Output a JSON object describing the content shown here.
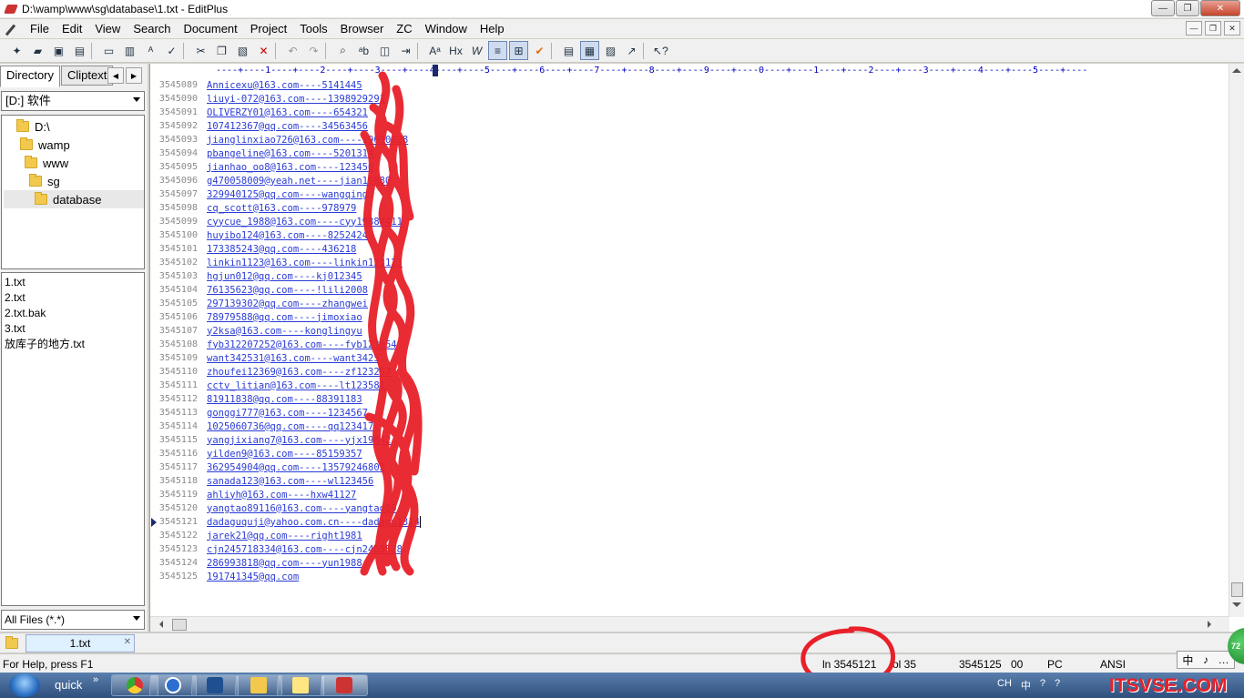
{
  "window": {
    "title": "D:\\wamp\\www\\sg\\database\\1.txt - EditPlus",
    "buttons": {
      "minimize": "—",
      "maximize": "❐",
      "close": "✕"
    }
  },
  "menu": {
    "items": [
      "File",
      "Edit",
      "View",
      "Search",
      "Document",
      "Project",
      "Tools",
      "Browser",
      "ZC",
      "Window",
      "Help"
    ],
    "mdi": {
      "minimize": "—",
      "restore": "❐",
      "close": "✕"
    }
  },
  "toolbar": {
    "icons": [
      "new-file-icon",
      "open-icon",
      "save-icon",
      "save-all-icon",
      "print-preview-icon",
      "print-icon",
      "spell-check-icon",
      "check-icon",
      "cut-icon",
      "copy-icon",
      "paste-icon",
      "delete-icon",
      "undo-icon",
      "redo-icon",
      "find-icon",
      "replace-icon",
      "goto-icon",
      "indent-icon",
      "font-icon",
      "hex-icon",
      "word-wrap-icon",
      "line-number-icon",
      "column-icon",
      "spellcheck-mark-icon",
      "browser-icon",
      "window-icon",
      "cliptext-icon",
      "export-icon",
      "help-icon"
    ]
  },
  "left_panel": {
    "tabs": [
      "Directory",
      "Cliptext"
    ],
    "drive": "[D:] 软件",
    "tree": [
      "D:\\",
      "wamp",
      "www",
      "sg",
      "database"
    ],
    "files": [
      "1.txt",
      "2.txt",
      "2.txt.bak",
      "3.txt",
      "放库子的地方.txt"
    ],
    "filter": "All Files (*.*)"
  },
  "editor": {
    "ruler": "----+----1----+----2----+----3----+----4----+----5----+----6----+----7----+----8----+----9----+----0----+----1----+----2----+----3----+----4----+----5----+----",
    "lines": [
      {
        "num": "3545089",
        "text": "Annicexu@163.com----5141445"
      },
      {
        "num": "3545090",
        "text": "liuyi-072@163.com----1398929291"
      },
      {
        "num": "3545091",
        "text": "OLIVERZY01@163.com----654321"
      },
      {
        "num": "3545092",
        "text": "107412367@qq.com----34563456"
      },
      {
        "num": "3545093",
        "text": "jianglinxiao726@163.com----19690028"
      },
      {
        "num": "3545094",
        "text": "pbangeline@163.com----5201314"
      },
      {
        "num": "3545095",
        "text": "jianhao_oo8@163.com----123456"
      },
      {
        "num": "3545096",
        "text": "g470058009@yeah.net----jian19880"
      },
      {
        "num": "3545097",
        "text": "329940125@qq.com----wangqing"
      },
      {
        "num": "3545098",
        "text": "cq_scott@163.com----978979"
      },
      {
        "num": "3545099",
        "text": "cyycue_1988@163.com----cyy19884411"
      },
      {
        "num": "3545100",
        "text": "huyibo124@163.com----8252424"
      },
      {
        "num": "3545101",
        "text": "173385243@qq.com----436218"
      },
      {
        "num": "3545102",
        "text": "linkin1123@163.com----linkin123123"
      },
      {
        "num": "3545103",
        "text": "hgjun012@qq.com----kj012345"
      },
      {
        "num": "3545104",
        "text": "76135623@qq.com----!lili2008"
      },
      {
        "num": "3545105",
        "text": "297139302@qq.com----zhangwei"
      },
      {
        "num": "3545106",
        "text": "78979588@qq.com----jimoxiao"
      },
      {
        "num": "3545107",
        "text": "y2ksa@163.com----konglingyu"
      },
      {
        "num": "3545108",
        "text": "fyb312207252@163.com----fyb123654"
      },
      {
        "num": "3545109",
        "text": "want342531@163.com----want3425"
      },
      {
        "num": "3545110",
        "text": "zhoufei12369@163.com----zf123257"
      },
      {
        "num": "3545111",
        "text": "cctv_litian@163.com----lt123581"
      },
      {
        "num": "3545112",
        "text": "81911838@qq.com----88391183"
      },
      {
        "num": "3545113",
        "text": "gonggi777@163.com----1234567"
      },
      {
        "num": "3545114",
        "text": "1025060736@qq.com----qq123417"
      },
      {
        "num": "3545115",
        "text": "yangjixiang7@163.com----yjx19842"
      },
      {
        "num": "3545116",
        "text": "yilden9@163.com----85159357"
      },
      {
        "num": "3545117",
        "text": "362954904@qq.com----13579246802"
      },
      {
        "num": "3545118",
        "text": "sanada123@163.com----wl123456"
      },
      {
        "num": "3545119",
        "text": "ahliyh@163.com----hxw41127"
      },
      {
        "num": "3545120",
        "text": "yangtao89116@163.com----yangtao89"
      },
      {
        "num": "3545121",
        "text": "dadaguquji@yahoo.com.cn----dadagu1314"
      },
      {
        "num": "3545122",
        "text": "jarek21@qq.com----right1981"
      },
      {
        "num": "3545123",
        "text": "cjn245718334@163.com----cjn2455528"
      },
      {
        "num": "3545124",
        "text": "286993818@qq.com----yun1988"
      },
      {
        "num": "3545125",
        "text": "191741345@qq.com"
      }
    ]
  },
  "doc_tab": {
    "label": "1.txt",
    "close": "✕"
  },
  "status": {
    "help": "For Help, press F1",
    "line": "ln 3545121",
    "col": "ol 35",
    "total": "3545125",
    "zeros": "00",
    "format": "PC",
    "encoding": "ANSI"
  },
  "ime": [
    "中",
    "♪",
    "…"
  ],
  "badge": "72",
  "taskbar": {
    "quick": "quick",
    "quick_more": "»",
    "tray": [
      "CH",
      "中",
      "?",
      "?"
    ],
    "watermark": "ITSVSE.COM"
  },
  "colors": {
    "link_text": "#2a3bd6",
    "line_number": "#8a8a8a",
    "scribble": "#e8202a",
    "taskbar": "#2f4f7c"
  }
}
